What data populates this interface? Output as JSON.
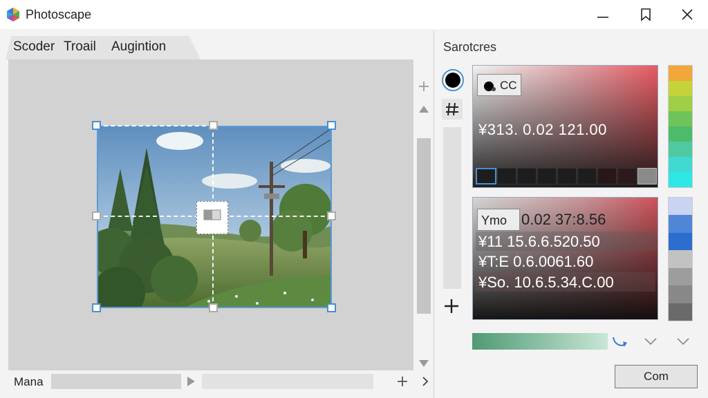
{
  "window": {
    "title": "Photoscape",
    "controls": [
      "minimize-icon",
      "restore-icon",
      "close-icon"
    ]
  },
  "tabs": [
    {
      "label": "Scoder"
    },
    {
      "label": "Troail"
    },
    {
      "label": "Augintion"
    }
  ],
  "bottom_bar": {
    "zoom_label": "Mana"
  },
  "panel": {
    "title": "Sarotcres",
    "tools": [
      "color-dot-icon",
      "grid-hash-icon",
      "plus-icon"
    ],
    "picker": {
      "chip_label": "CC",
      "readout": "¥313. 0.02 121.00"
    },
    "values": {
      "chip_label": "Ymo",
      "chip_value": "0.02 37:8.56",
      "rows": [
        "¥11 15.6.6.520.50",
        "¥T:E  0.6.0061.60",
        "¥So. 10.6.5.34.C.00"
      ]
    },
    "palette_top": [
      "#f1a73a",
      "#c5d33b",
      "#9fce47",
      "#6ec45a",
      "#4dbc6a",
      "#4fc9a0",
      "#3fd9d2",
      "#2fe6e6"
    ],
    "palette_bottom": [
      "#c9d4f2",
      "#4f86d6",
      "#2b6ecd",
      "#c2c2c2",
      "#9d9d9d",
      "#888888",
      "#6a6a6a"
    ],
    "ok_label": "Com"
  }
}
